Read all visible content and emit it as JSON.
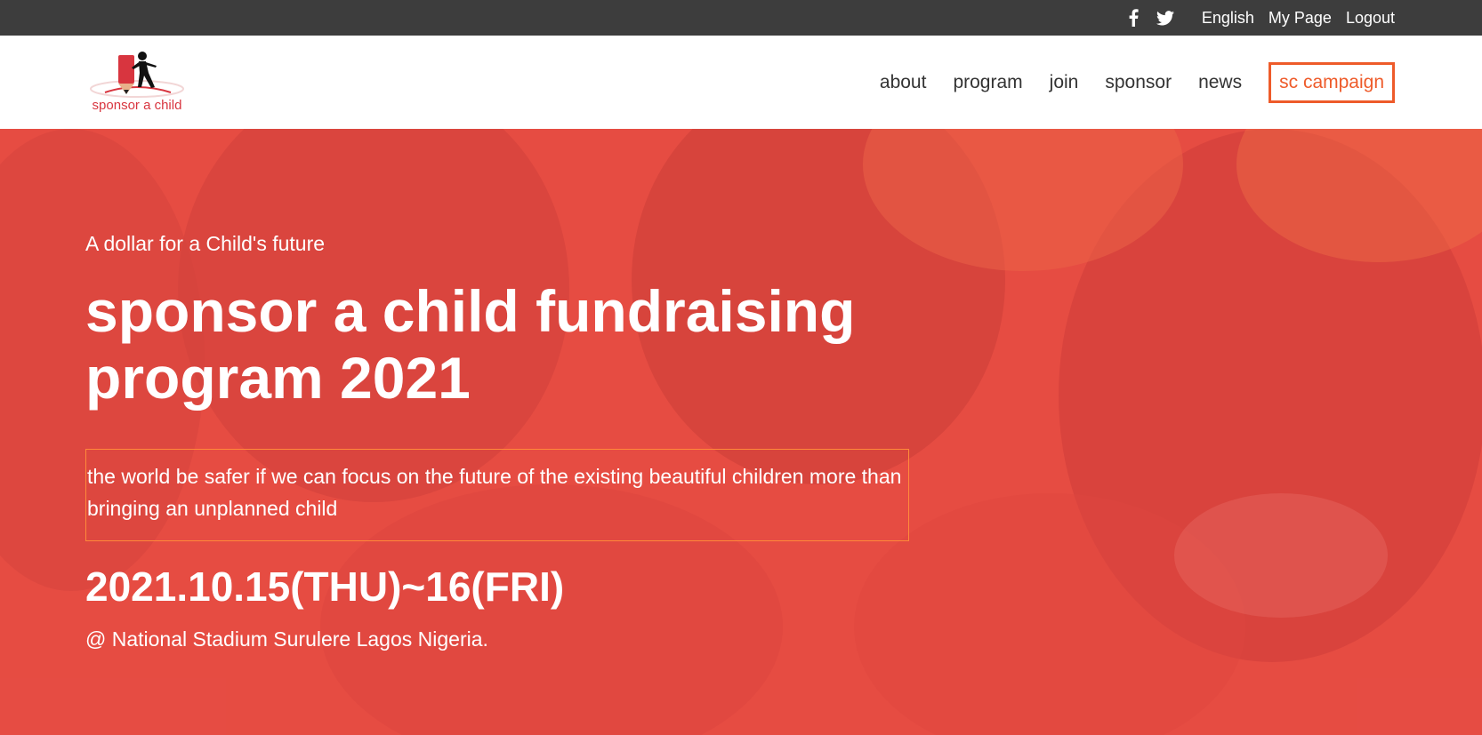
{
  "topbar": {
    "facebook_icon": "facebook-icon",
    "twitter_icon": "twitter-icon",
    "language": "English",
    "my_page": "My Page",
    "logout": "Logout"
  },
  "header": {
    "logo_text": "sponsor a child",
    "nav": [
      "about",
      "program",
      "join",
      "sponsor",
      "news"
    ],
    "campaign": "sc campaign"
  },
  "hero": {
    "tagline": "A dollar for a Child's future",
    "title": "sponsor a child fundraising program 2021",
    "quote": "the world be safer if we can focus on the future of the existing beautiful children more than bringing an unplanned child",
    "date": "2021.10.15(THU)~16(FRI)",
    "venue": "@ National Stadium Surulere Lagos Nigeria."
  },
  "colors": {
    "topbar_bg": "#3d3d3d",
    "accent": "#ee5b2a",
    "hero_overlay": "#f04646",
    "logo_red": "#d8353f"
  }
}
